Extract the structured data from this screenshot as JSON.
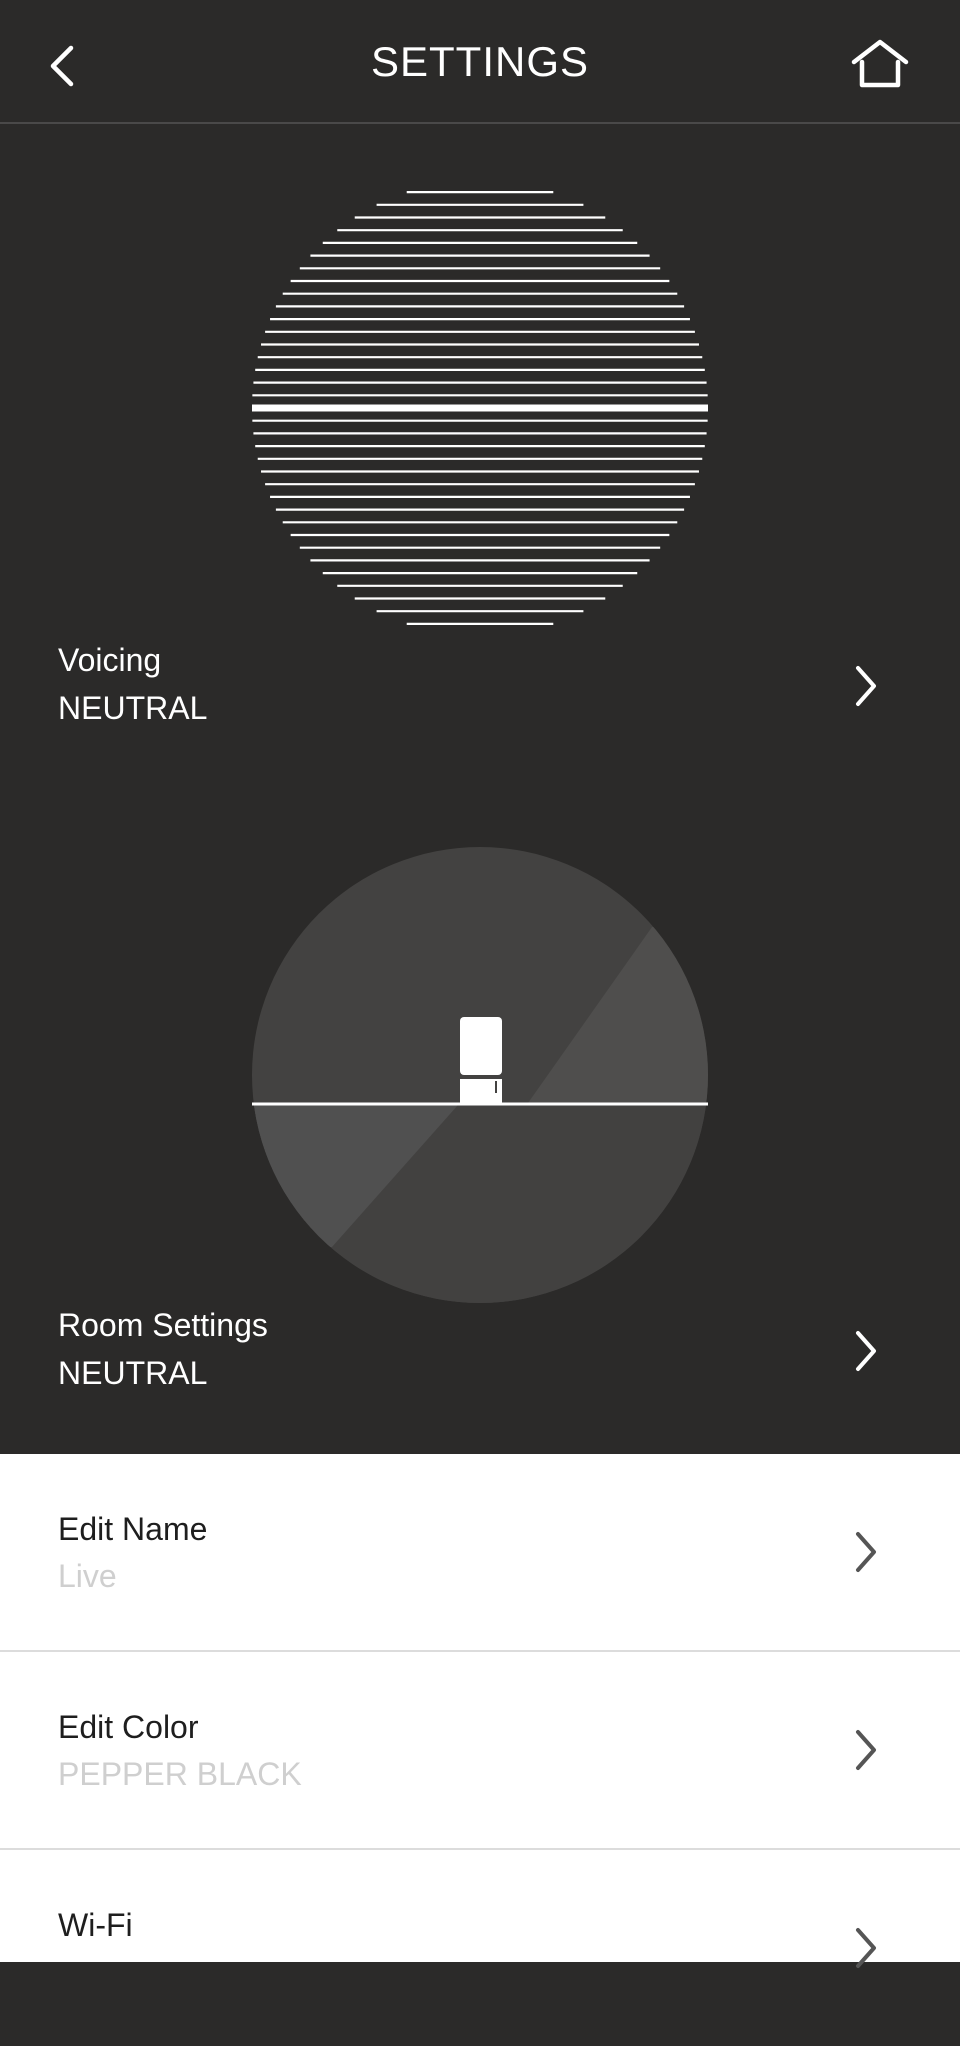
{
  "header": {
    "title": "SETTINGS",
    "back_icon": "chevron-left-icon",
    "home_icon": "home-icon"
  },
  "voicing": {
    "label": "Voicing",
    "value": "NEUTRAL"
  },
  "room_settings": {
    "label": "Room Settings",
    "value": "NEUTRAL"
  },
  "rows": [
    {
      "label": "Edit Name",
      "value": "Live"
    },
    {
      "label": "Edit Color",
      "value": "PEPPER BLACK"
    },
    {
      "label": "Wi-Fi",
      "value": ""
    }
  ],
  "colors": {
    "background_dark": "#2b2a29",
    "background_light": "#ffffff",
    "text_primary_dark": "#ffffff",
    "text_primary_light": "#1e1e1e",
    "text_secondary_light": "#cfcfcf",
    "chevron_light": "#555555"
  }
}
